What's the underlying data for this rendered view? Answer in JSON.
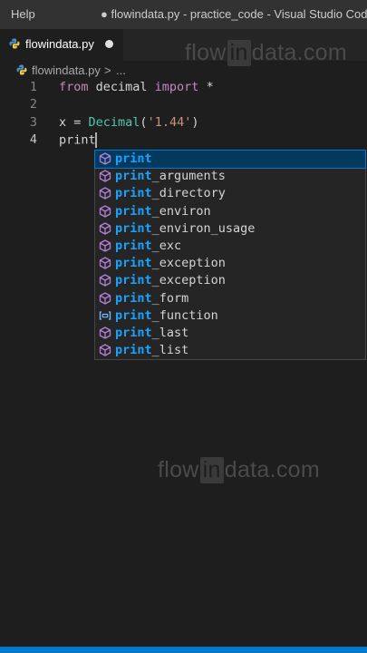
{
  "titlebar": {
    "menu_help": "Help",
    "window_title": "● flowindata.py - practice_code - Visual Studio Code"
  },
  "tab": {
    "label": "flowindata.py",
    "icon": "python-icon",
    "dirty": true
  },
  "breadcrumb": {
    "file": "flowindata.py",
    "separator": ">",
    "more": "..."
  },
  "watermark": {
    "pre": "flow",
    "box": "in",
    "post": "data.com"
  },
  "editor": {
    "lines": [
      {
        "number": "1",
        "tokens": [
          {
            "text": "from",
            "kind": "kw"
          },
          {
            "text": " decimal ",
            "kind": "plain"
          },
          {
            "text": "import",
            "kind": "kw"
          },
          {
            "text": " *",
            "kind": "plain"
          }
        ]
      },
      {
        "number": "2",
        "tokens": []
      },
      {
        "number": "3",
        "tokens": [
          {
            "text": "x = ",
            "kind": "plain"
          },
          {
            "text": "Decimal",
            "kind": "cls"
          },
          {
            "text": "(",
            "kind": "plain"
          },
          {
            "text": "'1.44'",
            "kind": "str"
          },
          {
            "text": ")",
            "kind": "plain"
          }
        ]
      },
      {
        "number": "4",
        "tokens": [
          {
            "text": "print",
            "kind": "plain"
          }
        ]
      }
    ],
    "active_line": 4
  },
  "suggestions": {
    "typed": "print",
    "items": [
      {
        "label": "print",
        "icon": "module-icon",
        "selected": true
      },
      {
        "label": "print_arguments",
        "icon": "module-icon",
        "selected": false
      },
      {
        "label": "print_directory",
        "icon": "module-icon",
        "selected": false
      },
      {
        "label": "print_environ",
        "icon": "module-icon",
        "selected": false
      },
      {
        "label": "print_environ_usage",
        "icon": "module-icon",
        "selected": false
      },
      {
        "label": "print_exc",
        "icon": "module-icon",
        "selected": false
      },
      {
        "label": "print_exception",
        "icon": "module-icon",
        "selected": false
      },
      {
        "label": "print_exception",
        "icon": "module-icon",
        "selected": false
      },
      {
        "label": "print_form",
        "icon": "module-icon",
        "selected": false
      },
      {
        "label": "print_function",
        "icon": "variable-icon",
        "selected": false
      },
      {
        "label": "print_last",
        "icon": "module-icon",
        "selected": false
      },
      {
        "label": "print_list",
        "icon": "module-icon",
        "selected": false
      }
    ]
  },
  "colors": {
    "accent": "#007acc",
    "match": "#18a3ff",
    "selection": "#04395e",
    "icon_module": "#b180d7",
    "icon_variable": "#75beff"
  }
}
